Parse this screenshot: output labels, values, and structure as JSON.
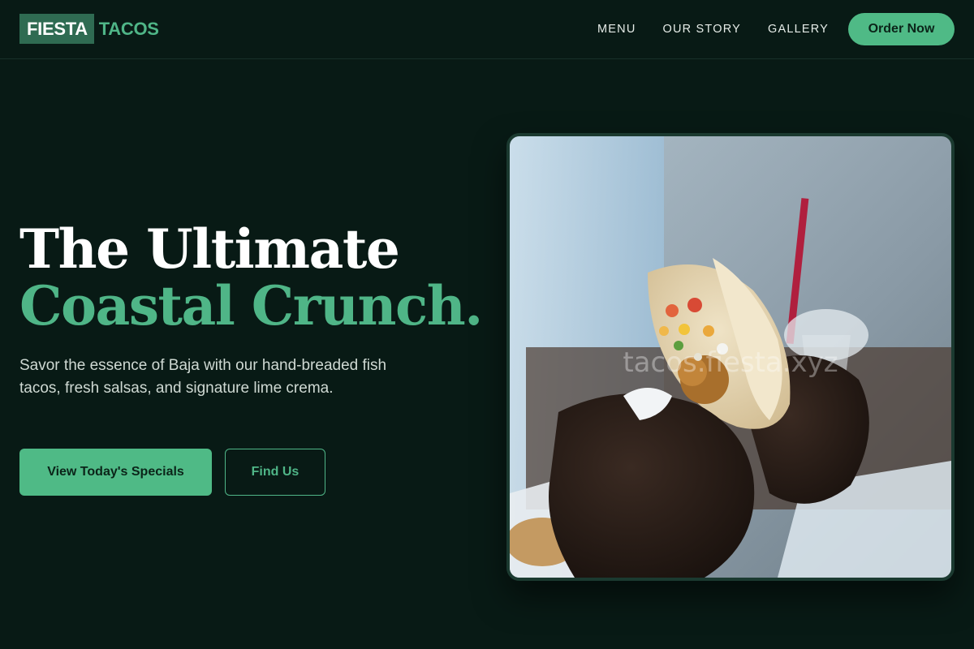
{
  "brand": {
    "box_text": "FIESTA",
    "rest_text": "TACOS"
  },
  "nav": {
    "links": [
      "MENU",
      "OUR STORY",
      "GALLERY"
    ],
    "cta": "Order Now"
  },
  "hero": {
    "headline_line1": "The Ultimate",
    "headline_line2": "Coastal Crunch.",
    "subtext": "Savor the essence of Baja with our hand-breaded fish tacos, fresh salsas, and signature lime crema.",
    "primary_button": "View Today's Specials",
    "secondary_button": "Find Us",
    "image_watermark": "tacos.fiesta.xyz"
  },
  "colors": {
    "background": "#081a15",
    "accent": "#4fba86",
    "logo_box": "#2f6b52"
  }
}
